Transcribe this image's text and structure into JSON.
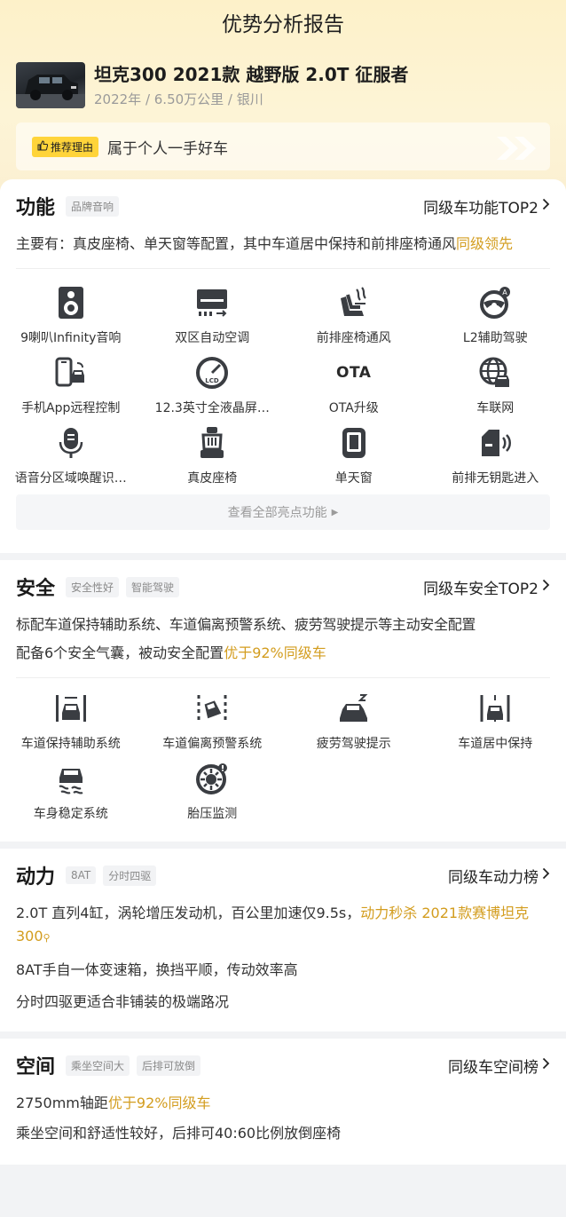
{
  "header": {
    "title": "优势分析报告",
    "car_name": "坦克300 2021款 越野版 2.0T 征服者",
    "car_meta": "2022年 / 6.50万公里 / 银川",
    "reason_badge": "推荐理由",
    "reason_text": "属于个人一手好车"
  },
  "function": {
    "title": "功能",
    "tags": [
      "品牌音响"
    ],
    "rank": "同级车功能TOP2",
    "desc_prefix": "主要有：真皮座椅、单天窗等配置，其中车道居中保持和前排座椅通风",
    "desc_highlight": "同级领先",
    "features": [
      {
        "label": "9喇叭Infinity音响",
        "icon": "speaker-icon"
      },
      {
        "label": "双区自动空调",
        "icon": "air-conditioner-icon"
      },
      {
        "label": "前排座椅通风",
        "icon": "seat-ventilation-icon"
      },
      {
        "label": "L2辅助驾驶",
        "icon": "steering-wheel-assist-icon"
      },
      {
        "label": "手机App远程控制",
        "icon": "phone-car-remote-icon"
      },
      {
        "label": "12.3英寸全液晶屏…",
        "icon": "lcd-gauge-icon"
      },
      {
        "label": "OTA升级",
        "icon": "ota-icon",
        "text": "OTA"
      },
      {
        "label": "车联网",
        "icon": "connected-car-globe-icon"
      },
      {
        "label": "语音分区域唤醒识…",
        "icon": "microphone-icon"
      },
      {
        "label": "真皮座椅",
        "icon": "leather-seat-icon"
      },
      {
        "label": "单天窗",
        "icon": "sunroof-icon"
      },
      {
        "label": "前排无钥匙进入",
        "icon": "keyless-entry-icon"
      }
    ],
    "view_all": "查看全部亮点功能"
  },
  "safety": {
    "title": "安全",
    "tags": [
      "安全性好",
      "智能驾驶"
    ],
    "rank": "同级车安全TOP2",
    "desc_line1": "标配车道保持辅助系统、车道偏离预警系统、疲劳驾驶提示等主动安全配置",
    "desc_line2_prefix": "配备6个安全气囊，被动安全配置",
    "desc_line2_highlight": "优于92%同级车",
    "features": [
      {
        "label": "车道保持辅助系统",
        "icon": "lane-keep-icon"
      },
      {
        "label": "车道偏离预警系统",
        "icon": "lane-departure-icon"
      },
      {
        "label": "疲劳驾驶提示",
        "icon": "fatigue-alert-icon"
      },
      {
        "label": "车道居中保持",
        "icon": "lane-center-icon"
      },
      {
        "label": "车身稳定系统",
        "icon": "stability-control-icon"
      },
      {
        "label": "胎压监测",
        "icon": "tire-pressure-icon"
      }
    ]
  },
  "power": {
    "title": "动力",
    "tags": [
      "8AT",
      "分时四驱"
    ],
    "rank": "同级车动力榜",
    "desc_line1_prefix": "2.0T 直列4缸，涡轮增压发动机，百公里加速仅9.5s，",
    "desc_line1_highlight": "动力秒杀 2021款赛博坦克300",
    "desc_line2": "8AT手自一体变速箱，换挡平顺，传动效率高",
    "desc_line3": "分时四驱更适合非铺装的极端路况"
  },
  "space": {
    "title": "空间",
    "tags": [
      "乘坐空间大",
      "后排可放倒"
    ],
    "rank": "同级车空间榜",
    "desc_line1_prefix": "2750mm轴距",
    "desc_line1_highlight": "优于92%同级车",
    "desc_line2": "乘坐空间和舒适性较好，后排可40:60比例放倒座椅"
  },
  "colors": {
    "accent": "#d39d1f",
    "badge": "#ffd43a",
    "header_bg": "#fdf1c9",
    "icon": "#3a3d42"
  }
}
